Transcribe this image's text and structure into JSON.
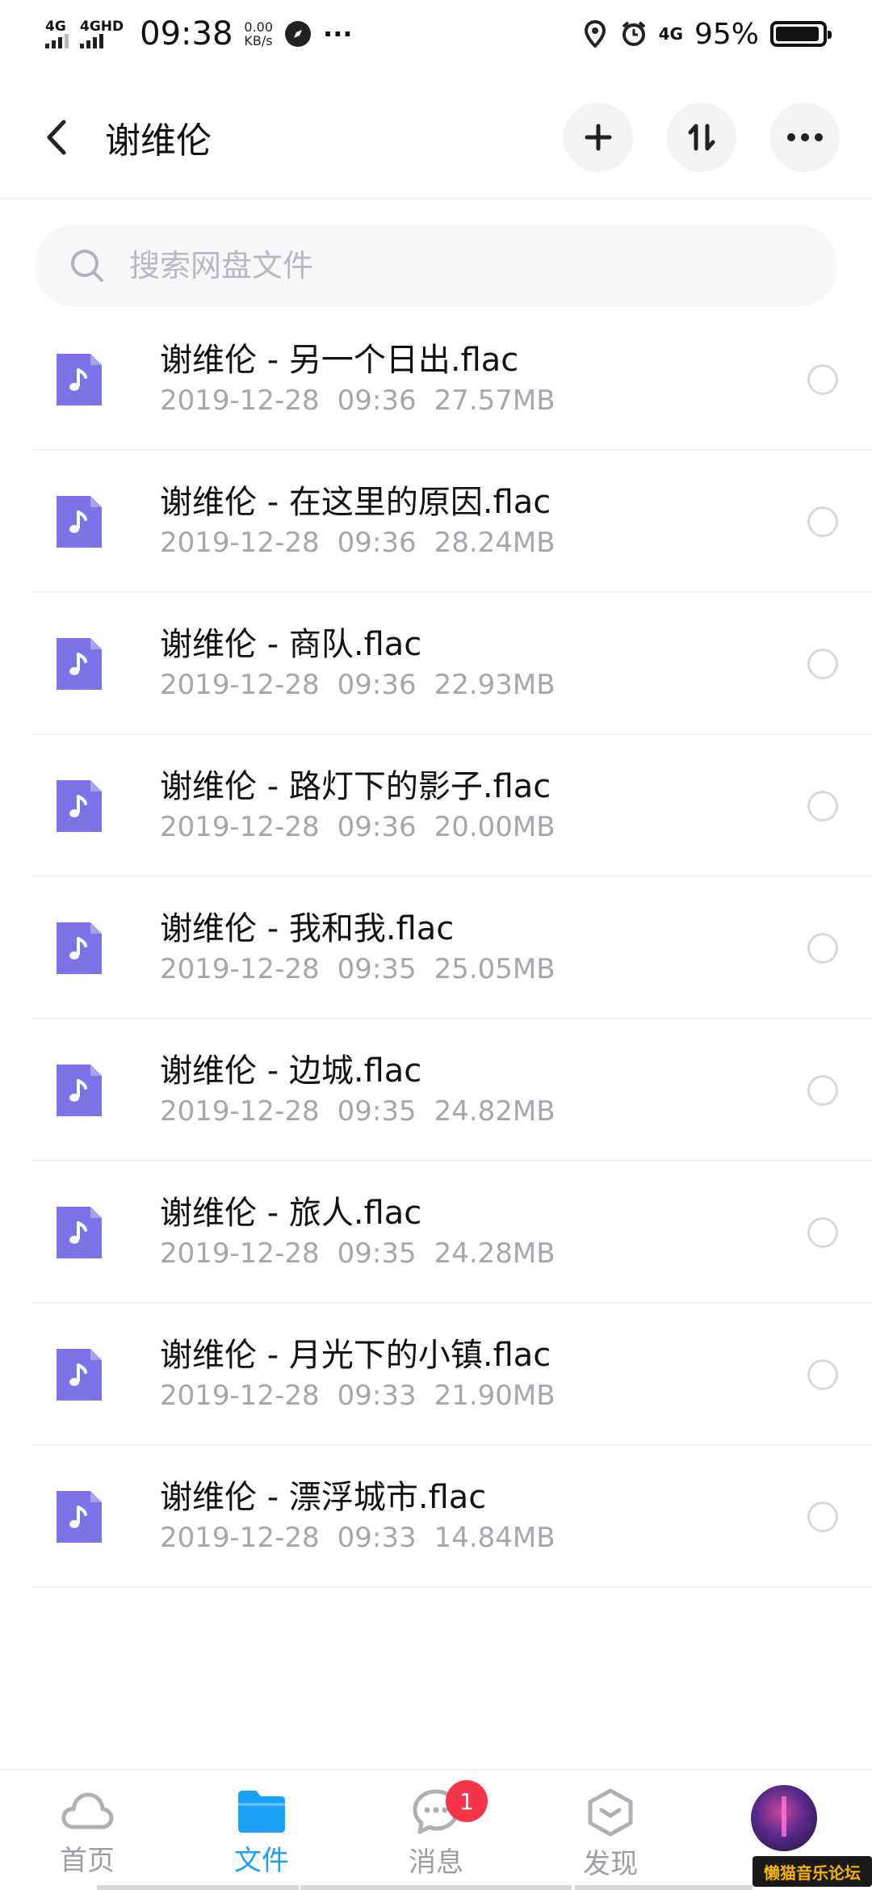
{
  "status_bar": {
    "network1": "4G",
    "network2": "4GHD",
    "time": "09:38",
    "speed_value": "0.00",
    "speed_unit": "KB/s",
    "more": "···",
    "network_right": "4G",
    "battery_pct": "95%",
    "battery_level": 0.95
  },
  "header": {
    "title": "谢维伦",
    "icons": [
      "back-icon",
      "plus-icon",
      "sort-icon",
      "more-icon"
    ]
  },
  "search": {
    "placeholder": "搜索网盘文件"
  },
  "files": [
    {
      "name": "谢维伦 - 另一个日出.flac",
      "date": "2019-12-28",
      "time": "09:36",
      "size": "27.57MB"
    },
    {
      "name": "谢维伦 - 在这里的原因.flac",
      "date": "2019-12-28",
      "time": "09:36",
      "size": "28.24MB"
    },
    {
      "name": "谢维伦 - 商队.flac",
      "date": "2019-12-28",
      "time": "09:36",
      "size": "22.93MB"
    },
    {
      "name": "谢维伦 - 路灯下的影子.flac",
      "date": "2019-12-28",
      "time": "09:36",
      "size": "20.00MB"
    },
    {
      "name": "谢维伦 - 我和我.flac",
      "date": "2019-12-28",
      "time": "09:35",
      "size": "25.05MB"
    },
    {
      "name": "谢维伦 - 边城.flac",
      "date": "2019-12-28",
      "time": "09:35",
      "size": "24.82MB"
    },
    {
      "name": "谢维伦 - 旅人.flac",
      "date": "2019-12-28",
      "time": "09:35",
      "size": "24.28MB"
    },
    {
      "name": "谢维伦 - 月光下的小镇.flac",
      "date": "2019-12-28",
      "time": "09:33",
      "size": "21.90MB"
    },
    {
      "name": "谢维伦 - 漂浮城市.flac",
      "date": "2019-12-28",
      "time": "09:33",
      "size": "14.84MB"
    }
  ],
  "tabs": {
    "home": "首页",
    "files": "文件",
    "messages": "消息",
    "messages_badge": "1",
    "discover": "发现"
  },
  "watermark": "懒猫音乐论坛",
  "colors": {
    "accent": "#1aa0f5",
    "file_icon": "#7c74e6",
    "badge": "#f5364a"
  }
}
